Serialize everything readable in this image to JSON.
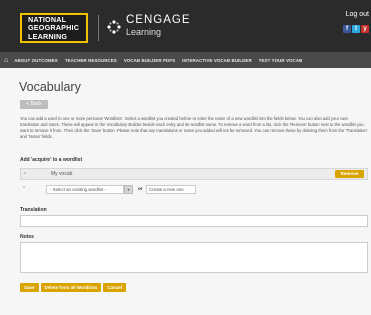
{
  "header": {
    "ng_logo_lines": [
      "NATIONAL",
      "GEOGRAPHIC",
      "LEARNING"
    ],
    "cengage_name": "CENGAGE",
    "cengage_tag": "Learning",
    "logout": "Log out",
    "social": [
      "f",
      "t",
      "y"
    ]
  },
  "nav": {
    "items": [
      "ABOUT OUTCOMES",
      "TEACHER RESOURCES",
      "VOCAB BUILDER PDFS",
      "INTERACTIVE VOCAB BUILDER",
      "TEST YOUR VOCAB"
    ]
  },
  "page": {
    "title": "Vocabulary",
    "back_label": "< Back",
    "description": "You can add a word to one or more personal 'Wordlists'. Select a wordlist you created before or enter the name of a new wordlist into the fields below. You can also add your own translation and notes. These will appear in the Vocabulary Builder beside each entry and its wordlist name. To remove a word from a list, click the 'Remove' button next to the wordlist you want to remove it from. Then click the 'Save' button. Please note that any translations or notes you added will not be removed. You can remove these by deleting them from the 'Translation' and 'Notes' fields."
  },
  "form": {
    "add_label": "Add 'acquire' to a wordlist",
    "existing_list_name": "My vocab",
    "remove_label": "Remove",
    "select_placeholder": "- Select an existing wordlist -",
    "or_label": "or",
    "create_placeholder": "Create a new one",
    "translation_label": "Translation",
    "translation_value": "",
    "notes_label": "Notes",
    "notes_value": ""
  },
  "actions": {
    "save": "Save",
    "delete": "Delete from all Wordlists",
    "cancel": "Cancel"
  },
  "colors": {
    "accent": "#d9a400",
    "header_bg": "#2b2b2b",
    "nav_bg": "#4a4a4a"
  }
}
